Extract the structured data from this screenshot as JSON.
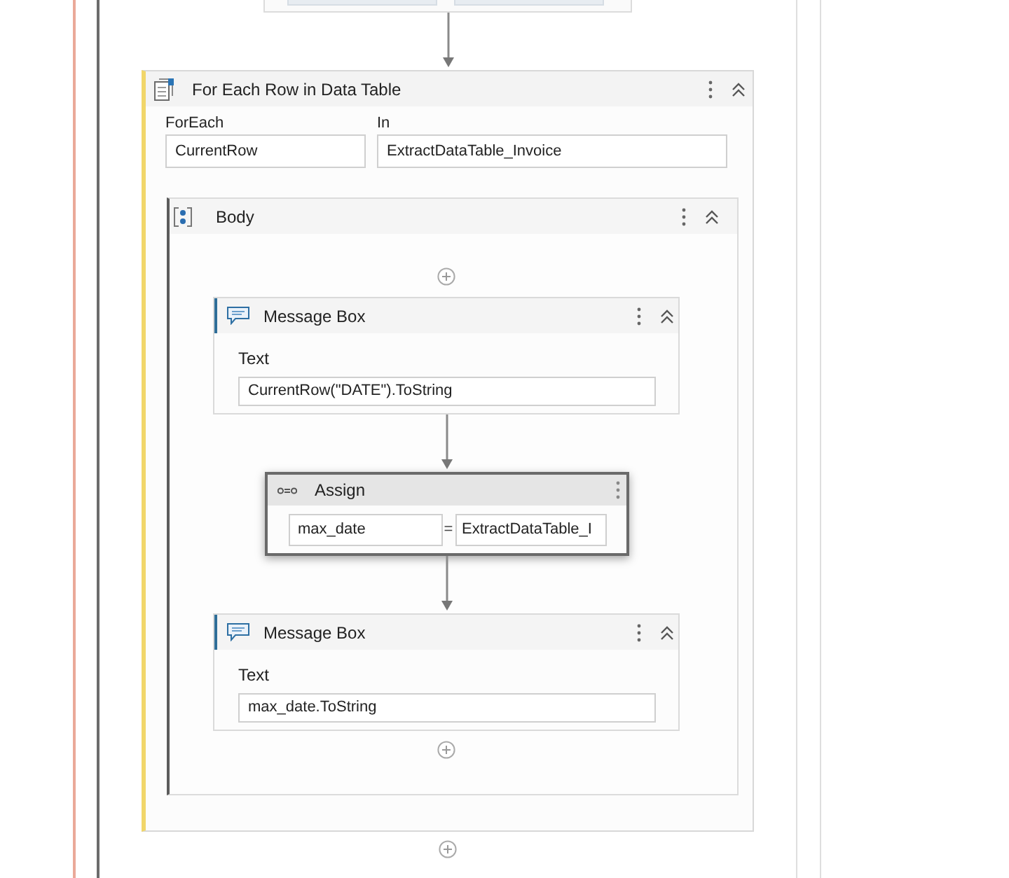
{
  "for_each": {
    "title": "For Each Row in Data Table",
    "fields": [
      {
        "label": "ForEach",
        "value": "CurrentRow"
      },
      {
        "label": "In",
        "value": "ExtractDataTable_Invoice"
      }
    ],
    "body": {
      "title": "Body",
      "activities": [
        {
          "kind": "message_box",
          "title": "Message Box",
          "label": "Text",
          "value": "CurrentRow(\"DATE\").ToString",
          "selected": false
        },
        {
          "kind": "assign",
          "title": "Assign",
          "to": "max_date",
          "operator": "=",
          "value": "ExtractDataTable_I",
          "selected": true
        },
        {
          "kind": "message_box",
          "title": "Message Box",
          "label": "Text",
          "value": "max_date.ToString",
          "selected": false
        }
      ]
    }
  }
}
